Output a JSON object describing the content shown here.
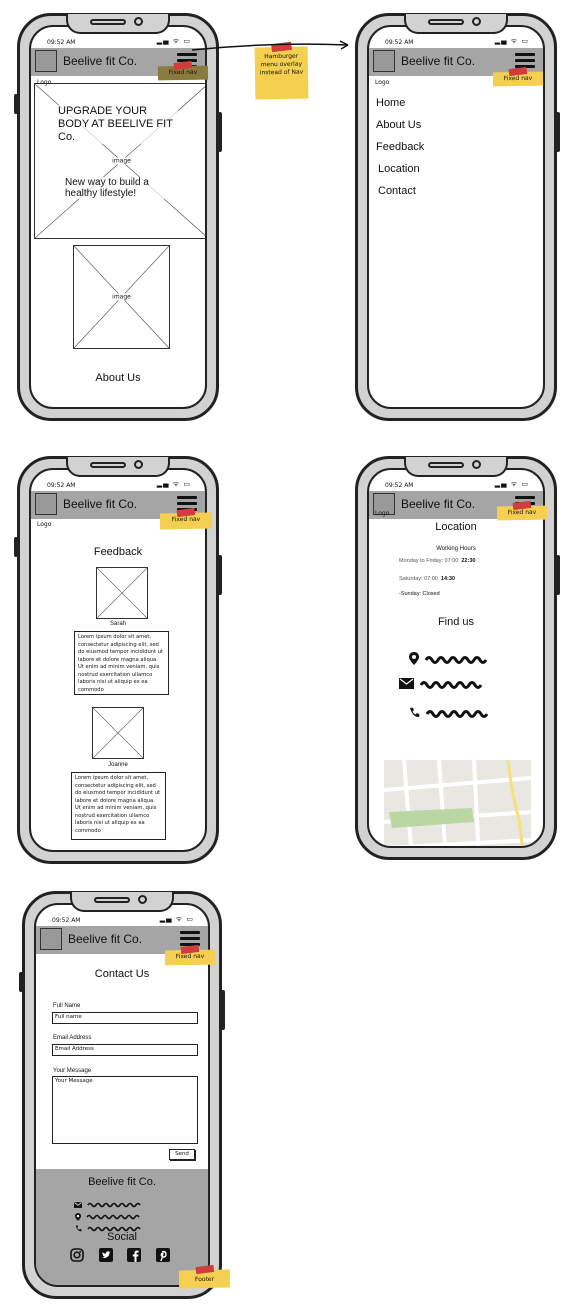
{
  "status": {
    "time": "09:52 AM",
    "icons": "▂▄ ᯤ ▭"
  },
  "nav": {
    "brand": "Beelive fit Co.",
    "logo_label": "Logo",
    "fixed_nav_note": "Fixed nav"
  },
  "home": {
    "headline": "UPGRADE YOUR BODY AT BEELIVE FIT Co.",
    "tagline": "New way to build a healthy lifestyle!",
    "image_label": "image",
    "about_title": "About Us"
  },
  "annotation": {
    "hamburger_note": "Hamburger menu overlay instead of Nav"
  },
  "menu": {
    "items": [
      "Home",
      "About Us",
      "Feedback",
      "Location",
      "Contact"
    ]
  },
  "feedback": {
    "title": "Feedback",
    "reviews": [
      {
        "name": "Sarah",
        "text": "Lorem ipsum dolor sit amet, consectetur adipiscing elit, sed do eiusmod tempor incididunt ut labore et dolore magna aliqua. Ut enim ad minim veniam, quis nostrud exercitation ullamco laboris nisi ut aliquip ex ea commodo"
      },
      {
        "name": "Joanne",
        "text": "Lorem ipsum dolor sit amet, consectetur adipiscing elit, sed do eiusmod tempor incididunt ut labore et dolore magna aliqua. Ut enim ad minim veniam, quis nostrud exercitation ullamco laboris nisi ut aliquip ex ea commodo"
      }
    ]
  },
  "location": {
    "title": "Location",
    "hours_title": "Working Hours",
    "hours": [
      {
        "days": "Monday to Friday: 07:00",
        "close": "22:30"
      },
      {
        "days": "Saturday: 07:00",
        "close": "14:30"
      },
      {
        "days": "-Sunday: Closed",
        "close": ""
      }
    ],
    "find_us": "Find us",
    "contact_icons": [
      "map-pin-icon",
      "envelope-icon",
      "phone-icon"
    ]
  },
  "contact": {
    "title": "Contact Us",
    "full_name_label": "Full Name",
    "full_name_placeholder": "Full name",
    "email_label": "Email Address",
    "email_placeholder": "Email Address",
    "message_label": "Your Message",
    "message_placeholder": "Your Message",
    "send_label": "Send"
  },
  "footer": {
    "brand": "Beelive fit Co.",
    "social_title": "Social",
    "social_icons": [
      "instagram-icon",
      "twitter-icon",
      "facebook-icon",
      "pinterest-icon"
    ],
    "footer_note": "Footer"
  },
  "colors": {
    "navbar": "#a5a5a5",
    "sticky_note": "#f5cf4f",
    "tape": "#d23c3c",
    "map_park": "#b9d6a3",
    "map_road": "#f3e27a"
  }
}
